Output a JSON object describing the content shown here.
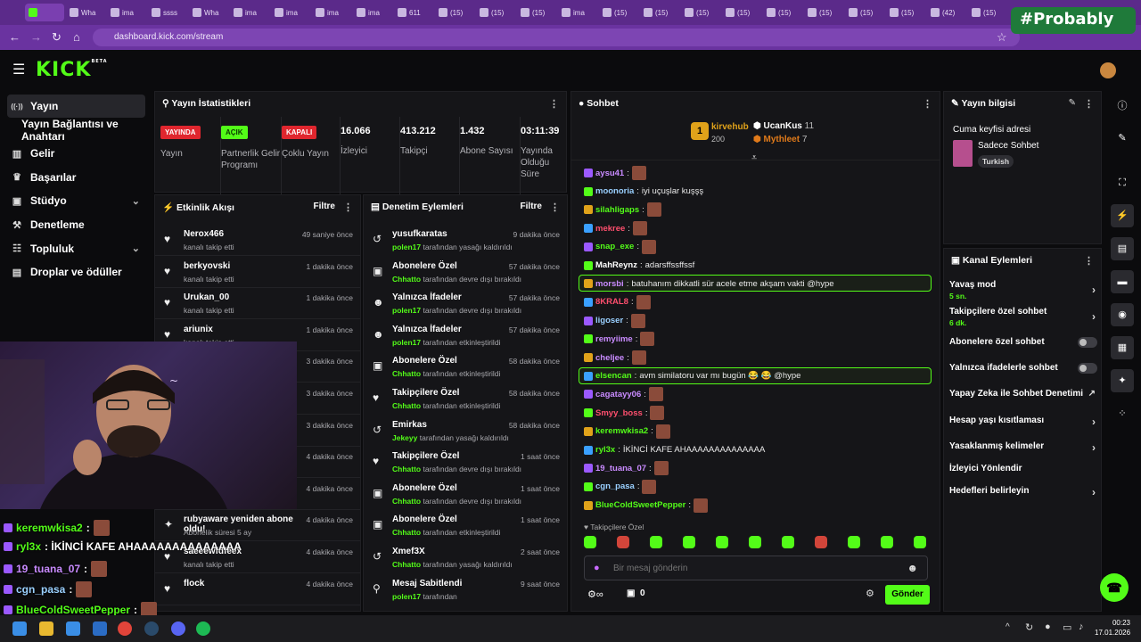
{
  "browser": {
    "tabs": [
      {
        "label": "",
        "active": true
      },
      {
        "label": "Wha"
      },
      {
        "label": "ima"
      },
      {
        "label": "ssss"
      },
      {
        "label": "Wha"
      },
      {
        "label": "ima"
      },
      {
        "label": "ima"
      },
      {
        "label": "ima"
      },
      {
        "label": "ima"
      },
      {
        "label": "611"
      },
      {
        "label": "(15)"
      },
      {
        "label": "(15)"
      },
      {
        "label": "(15)"
      },
      {
        "label": "ima"
      },
      {
        "label": "(15)"
      },
      {
        "label": "(15)"
      },
      {
        "label": "(15)"
      },
      {
        "label": "(15)"
      },
      {
        "label": "(15)"
      },
      {
        "label": "(15)"
      },
      {
        "label": "(15)"
      },
      {
        "label": "(15)"
      },
      {
        "label": "(42)"
      },
      {
        "label": "(15)"
      }
    ],
    "url": "dashboard.kick.com/stream",
    "overlay_text": "#Probably"
  },
  "kick": {
    "logo": "KICK",
    "beta": "BETA"
  },
  "sidebar": {
    "items": [
      {
        "label": "Yayın",
        "icon": "broadcast-icon",
        "active": true
      },
      {
        "label": "Yayın Bağlantısı ve Anahtarı",
        "icon": ""
      },
      {
        "label": "Gelir",
        "icon": "chart-icon"
      },
      {
        "label": "Başarılar",
        "icon": "trophy-icon"
      },
      {
        "label": "Stüdyo",
        "icon": "studio-icon",
        "chevron": true
      },
      {
        "label": "Denetleme",
        "icon": "wrench-icon"
      },
      {
        "label": "Topluluk",
        "icon": "community-icon",
        "chevron": true
      },
      {
        "label": "Droplar ve ödüller",
        "icon": "gift-icon"
      }
    ]
  },
  "stats": {
    "title": "Yayın İstatistikleri",
    "cards": [
      {
        "badge": "YAYINDA",
        "label": "Yayın",
        "color": "#e0262e"
      },
      {
        "badge": "AÇIK",
        "label": "Partnerlik Gelir Programı",
        "color": "#53fc18"
      },
      {
        "badge": "KAPALI",
        "label": "Çoklu Yayın",
        "color": "#e0262e"
      },
      {
        "value": "16.066",
        "label": "İzleyici"
      },
      {
        "value": "413.212",
        "label": "Takipçi"
      },
      {
        "value": "1.432",
        "label": "Abone Sayısı"
      },
      {
        "value": "03:11:39",
        "label": "Yayında Olduğu Süre"
      }
    ]
  },
  "activity": {
    "title": "Etkinlik Akışı",
    "filter": "Filtre",
    "rows": [
      {
        "name": "Nerox466",
        "sub": "kanalı takip etti",
        "time": "49 saniye önce",
        "icon": "♥"
      },
      {
        "name": "berkyovski",
        "sub": "kanalı takip etti",
        "time": "1 dakika önce",
        "icon": "♥"
      },
      {
        "name": "Urukan_00",
        "sub": "kanalı takip etti",
        "time": "1 dakika önce",
        "icon": "♥"
      },
      {
        "name": "ariunix",
        "sub": "kanalı takip etti",
        "time": "1 dakika önce",
        "icon": "♥"
      },
      {
        "name": "",
        "sub": "",
        "time": "3 dakika önce",
        "icon": ""
      },
      {
        "name": "",
        "sub": "",
        "time": "3 dakika önce",
        "icon": ""
      },
      {
        "name": "",
        "sub": "",
        "time": "3 dakika önce",
        "icon": ""
      },
      {
        "name": "",
        "sub": "",
        "time": "4 dakika önce",
        "icon": ""
      },
      {
        "name": "",
        "sub": "kanalı takip etti",
        "time": "4 dakika önce",
        "icon": ""
      },
      {
        "name": "rubyaware yeniden abone oldu!",
        "sub": "Abonelik süresi 5 ay",
        "time": "4 dakika önce",
        "icon": "✦"
      },
      {
        "name": "saeeewfdfeex",
        "sub": "kanalı takip etti",
        "time": "4 dakika önce",
        "icon": "♥"
      },
      {
        "name": "flock",
        "sub": "",
        "time": "4 dakika önce",
        "icon": "♥"
      }
    ]
  },
  "moderation": {
    "title": "Denetim Eylemleri",
    "filter": "Filtre",
    "rows": [
      {
        "title": "yusufkaratas",
        "user": "polen17",
        "action": "tarafından yasağı kaldırıldı",
        "time": "9 dakika önce",
        "icon": "↺"
      },
      {
        "title": "Abonelere Özel",
        "user": "Chhatto",
        "action": "tarafından devre dışı bırakıldı",
        "time": "57 dakika önce",
        "icon": "▣"
      },
      {
        "title": "Yalnızca İfadeler",
        "user": "polen17",
        "action": "tarafından devre dışı bırakıldı",
        "time": "57 dakika önce",
        "icon": "☻"
      },
      {
        "title": "Yalnızca İfadeler",
        "user": "polen17",
        "action": "tarafından etkinleştirildi",
        "time": "57 dakika önce",
        "icon": "☻"
      },
      {
        "title": "Abonelere Özel",
        "user": "Chhatto",
        "action": "tarafından etkinleştirildi",
        "time": "58 dakika önce",
        "icon": "▣"
      },
      {
        "title": "Takipçilere Özel",
        "user": "Chhatto",
        "action": "tarafından etkinleştirildi",
        "time": "58 dakika önce",
        "icon": "♥"
      },
      {
        "title": "Emirkas",
        "user": "Jekeyy",
        "action": "tarafından yasağı kaldırıldı",
        "time": "58 dakika önce",
        "icon": "↺"
      },
      {
        "title": "Takipçilere Özel",
        "user": "Chhatto",
        "action": "tarafından devre dışı bırakıldı",
        "time": "1 saat önce",
        "icon": "♥"
      },
      {
        "title": "Abonelere Özel",
        "user": "Chhatto",
        "action": "tarafından devre dışı bırakıldı",
        "time": "1 saat önce",
        "icon": "▣"
      },
      {
        "title": "Abonelere Özel",
        "user": "Chhatto",
        "action": "tarafından etkinleştirildi",
        "time": "1 saat önce",
        "icon": "▣"
      },
      {
        "title": "Xmef3X",
        "user": "Chhatto",
        "action": "tarafından yasağı kaldırıldı",
        "time": "2 saat önce",
        "icon": "↺"
      },
      {
        "title": "Mesaj Sabitlendi",
        "user": "polen17",
        "action": "tarafından",
        "time": "9 saat önce",
        "icon": "⚲"
      }
    ]
  },
  "chat": {
    "title": "Sohbet",
    "leaderboard": [
      {
        "rank": "1",
        "name": "kirvehub",
        "count": "200"
      },
      {
        "name": "UcanKus",
        "count": "11"
      },
      {
        "name": "Mythleet",
        "count": "7"
      }
    ],
    "messages": [
      {
        "user": "aysu41",
        "text": "",
        "color": "#c98bff",
        "emote": true
      },
      {
        "user": "moonoria",
        "text": "iyi uçuşlar kuşşş",
        "color": "#9ad0ff"
      },
      {
        "user": "silahligaps",
        "text": "",
        "color": "#53fc18",
        "emote": true
      },
      {
        "user": "mekree",
        "text": "",
        "color": "#ff4f6e",
        "emote": true
      },
      {
        "user": "snap_exe",
        "text": "",
        "color": "#53fc18",
        "emote": true
      },
      {
        "user": "MahReynz",
        "text": "adarsffssffssf",
        "color": "#ffffff"
      },
      {
        "user": "morsbi",
        "text": "batuhanım dikkatli sür acele etme akşam vakti @hype",
        "color": "#c98bff",
        "highlight": true
      },
      {
        "user": "8KRAL8",
        "text": "",
        "color": "#ff4f6e",
        "emote": true
      },
      {
        "user": "ligoser",
        "text": "",
        "color": "#9ad0ff",
        "emote": true
      },
      {
        "user": "remyiime",
        "text": "",
        "color": "#c98bff",
        "emote": true
      },
      {
        "user": "cheljee",
        "text": "",
        "color": "#c98bff",
        "emote": true
      },
      {
        "user": "elsencan",
        "text": "avm similatoru var mı bugün 😂 😂 @hype",
        "color": "#53fc18",
        "highlight": true
      },
      {
        "user": "cagatayy06",
        "text": "",
        "color": "#c98bff",
        "emote": true
      },
      {
        "user": "Smyy_boss",
        "text": "",
        "color": "#ff4f6e",
        "emote": true
      },
      {
        "user": "keremwkisa2",
        "text": "",
        "color": "#53fc18",
        "emote": true
      },
      {
        "user": "ryl3x",
        "text": "İKİNCİ KAFE AHAAAAAAAAAAAAAA",
        "color": "#53fc18"
      },
      {
        "user": "19_tuana_07",
        "text": "",
        "color": "#c98bff",
        "emote": true
      },
      {
        "user": "cgn_pasa",
        "text": "",
        "color": "#9ad0ff",
        "emote": true
      },
      {
        "user": "BlueColdSweetPepper",
        "text": "",
        "color": "#53fc18",
        "emote": true
      }
    ],
    "mode_label": "Takipçilere Özel",
    "placeholder": "Bir mesaj gönderin",
    "points": "0",
    "send_label": "Gönder"
  },
  "stream_info": {
    "title": "Yayın bilgisi",
    "stream_title": "Cuma keyfisi adresi",
    "category": "Sadece Sohbet",
    "tag": "Turkish"
  },
  "channel_actions": {
    "title": "Kanal Eylemleri",
    "items": [
      {
        "label": "Yavaş mod",
        "sub": "5 sn.",
        "type": "chevron"
      },
      {
        "label": "Takipçilere özel sohbet",
        "sub": "6 dk.",
        "type": "chevron"
      },
      {
        "label": "Abonelere özel sohbet",
        "type": "toggle"
      },
      {
        "label": "Yalnızca ifadelerle sohbet",
        "type": "toggle"
      },
      {
        "label": "Yapay Zeka ile Sohbet Denetimi",
        "type": "external"
      },
      {
        "label": "Hesap yaşı kısıtlaması",
        "type": "chevron"
      },
      {
        "label": "Yasaklanmış kelimeler",
        "type": "chevron"
      },
      {
        "label": "İzleyici Yönlendir",
        "type": "none"
      },
      {
        "label": "Hedefleri belirleyin",
        "type": "chevron"
      }
    ]
  },
  "overlay_chat": [
    {
      "user": "keremwkisa2",
      "text": ":",
      "color": "#53fc18"
    },
    {
      "user": "ryl3x",
      "text": ": İKİNCİ KAFE AHAAAAAAAAAAAAAA",
      "color": "#53fc18"
    },
    {
      "user": "19_tuana_07",
      "text": ":",
      "color": "#c98bff"
    },
    {
      "user": "cgn_pasa",
      "text": ":",
      "color": "#9ad0ff"
    },
    {
      "user": "BlueColdSweetPepper",
      "text": ":",
      "color": "#53fc18"
    }
  ],
  "taskbar": {
    "time": "00:23",
    "date": "17.01.2026"
  },
  "colors": {
    "brand": "#53fc18",
    "live": "#e0262e",
    "panel": "#151518"
  }
}
